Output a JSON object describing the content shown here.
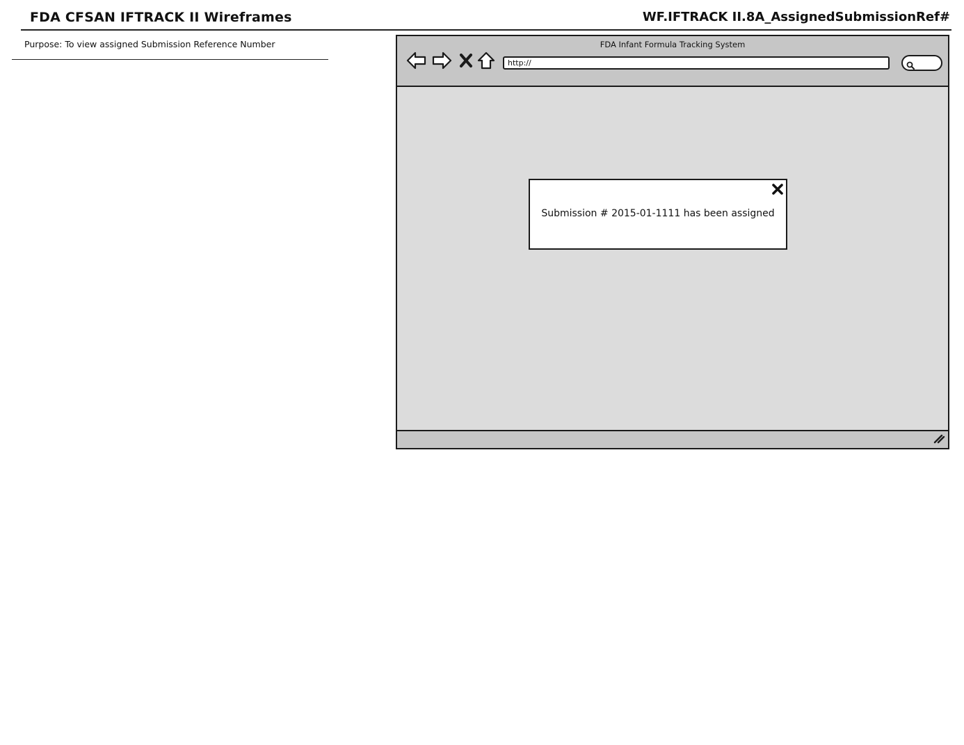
{
  "document": {
    "title": "FDA CFSAN IFTRACK II Wireframes",
    "reference": "WF.IFTRACK II.8A_AssignedSubmissionRef#",
    "purpose": "Purpose: To view assigned Submission Reference Number"
  },
  "browser": {
    "window_title": "FDA Infant Formula Tracking System",
    "url_value": "http://",
    "icons": [
      "back-arrow-icon",
      "forward-arrow-icon",
      "stop-icon",
      "home-icon",
      "search-icon",
      "resize-grip-icon"
    ]
  },
  "dialog": {
    "message": "Submission # 2015-01-1111 has been assigned",
    "close_icon": "close-icon"
  },
  "colors": {
    "chrome": "#c6c6c6",
    "content": "#dcdcdc",
    "stroke": "#1a1a1a"
  }
}
